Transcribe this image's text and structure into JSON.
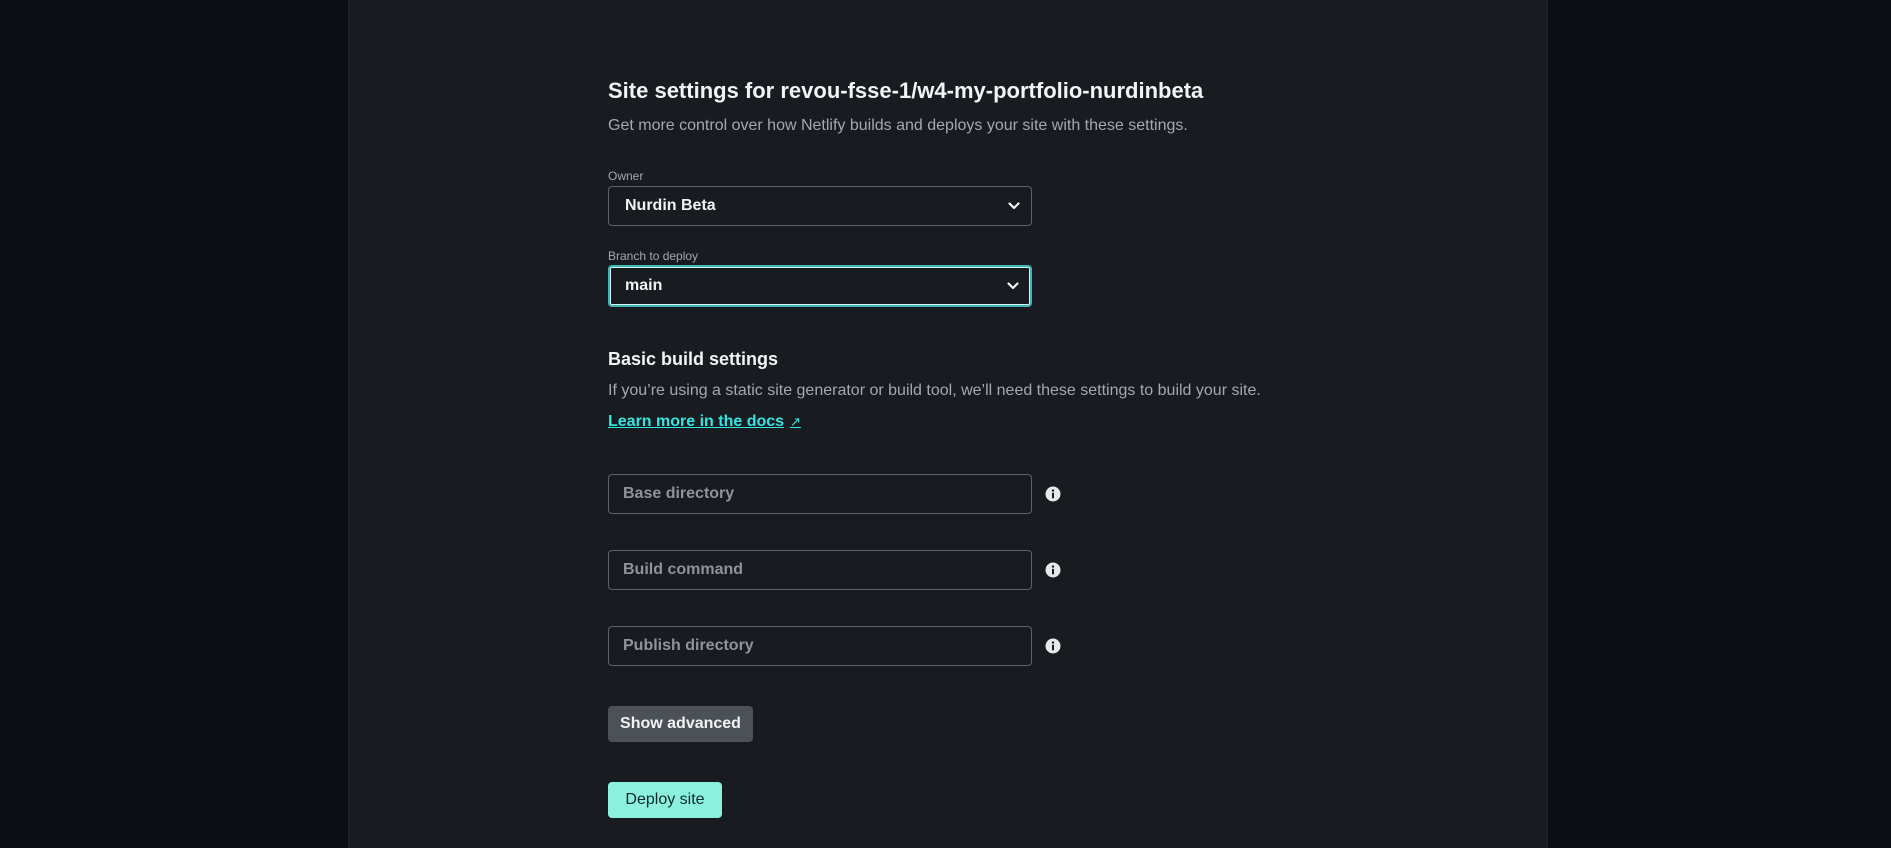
{
  "header": {
    "title": "Site settings for revou-fsse-1/w4-my-portfolio-nurdinbeta",
    "subtitle": "Get more control over how Netlify builds and deploys your site with these settings."
  },
  "owner": {
    "label": "Owner",
    "value": "Nurdin Beta"
  },
  "branch": {
    "label": "Branch to deploy",
    "value": "main"
  },
  "build": {
    "title": "Basic build settings",
    "description": "If you’re using a static site generator or build tool, we’ll need these settings to build your site.",
    "docs_link": "Learn more in the docs",
    "docs_link_icon": "↗",
    "base_directory_placeholder": "Base directory",
    "build_command_placeholder": "Build command",
    "publish_directory_placeholder": "Publish directory"
  },
  "actions": {
    "show_advanced": "Show advanced",
    "deploy": "Deploy site"
  },
  "colors": {
    "accent": "#32e6e2",
    "deploy_button": "#8bf0dc",
    "panel_bg": "#181b20",
    "page_bg": "#0b0e12"
  }
}
